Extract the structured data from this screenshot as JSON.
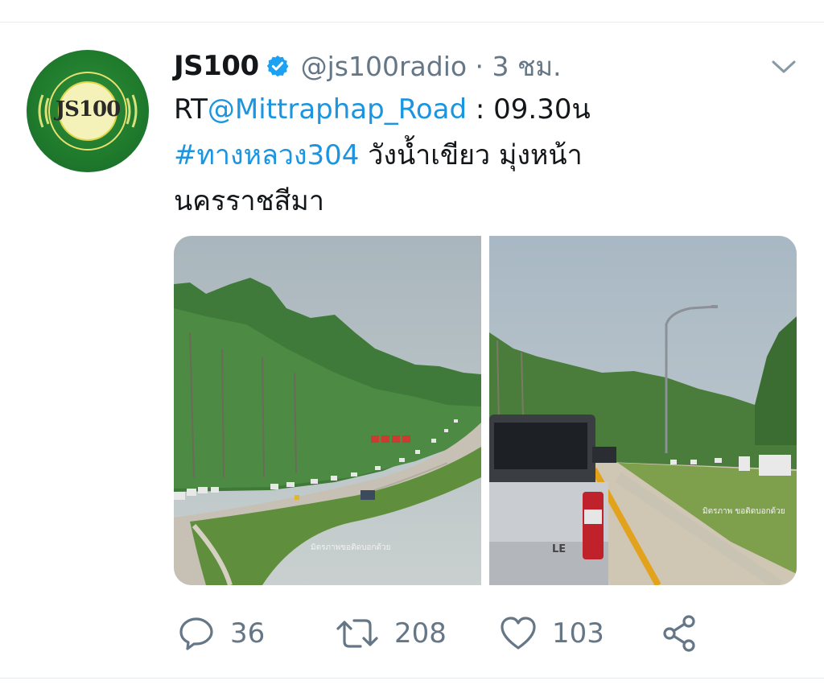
{
  "tweet": {
    "avatar_text": "JS100",
    "display_name": "JS100",
    "handle_and_time": "@js100radio · 3 ชม.",
    "text_rt": "RT",
    "text_mention": "@Mittraphap_Road",
    "text_time": " : 09.30น",
    "text_hashtag": "#ทางหลวง304",
    "text_line2_rest": " วังน้ำเขียว มุ่งหน้า",
    "text_line3": "นครราชสีมา",
    "photo_left_watermark": "มิตรภาพขอติดบอกด้วย",
    "photo_right_watermark": "มิตรภาพ ขอติดบอกด้วย",
    "photo_right_badge": "LE"
  },
  "actions": {
    "replies": "36",
    "retweets": "208",
    "likes": "103"
  },
  "colors": {
    "link": "#1b95e0",
    "secondary_text": "#657786",
    "verified_badge": "#1da1f2",
    "avatar_green": "#1f7a2c"
  },
  "icons": [
    "verified-badge-icon",
    "chevron-down-icon",
    "reply-icon",
    "retweet-icon",
    "like-icon",
    "share-icon"
  ]
}
